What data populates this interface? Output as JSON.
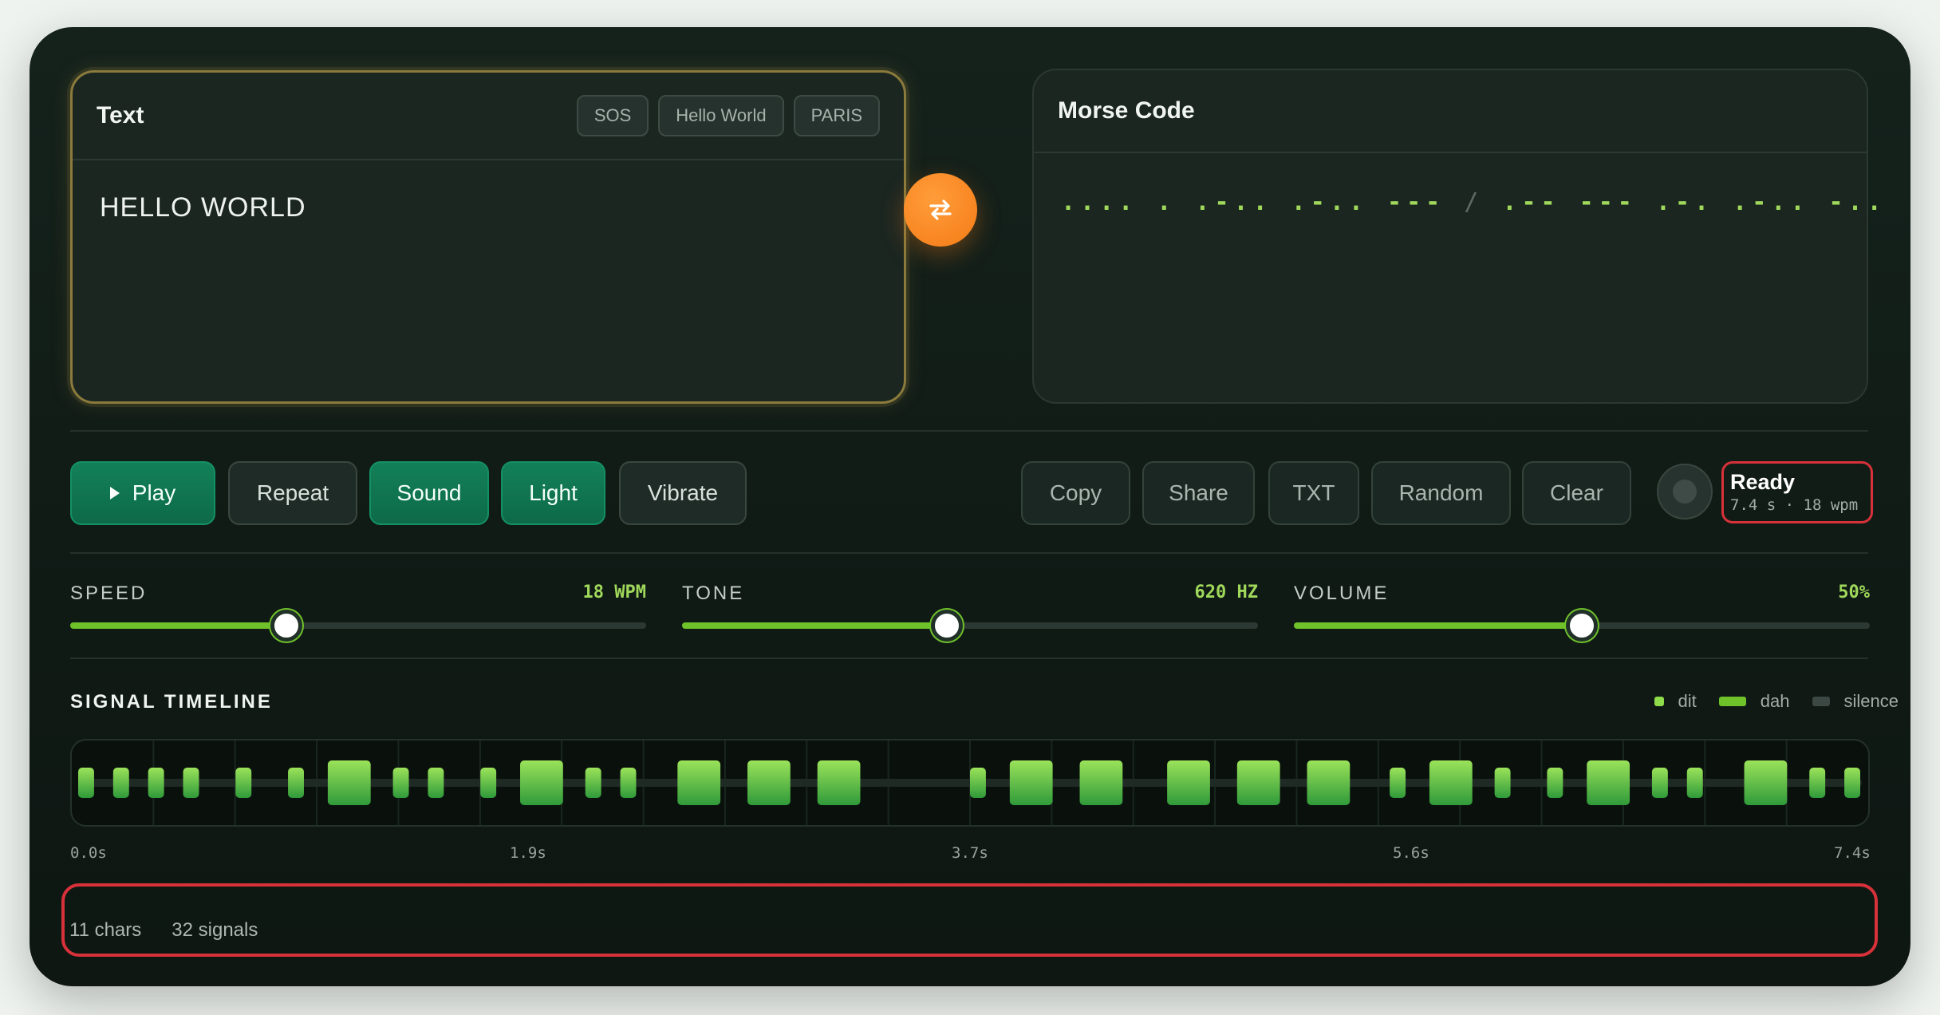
{
  "text_panel": {
    "title": "Text",
    "presets": [
      "SOS",
      "Hello World",
      "PARIS"
    ],
    "input_value": "HELLO WORLD"
  },
  "morse_panel": {
    "title": "Morse Code",
    "output": ".... . .-.. .-.. --- / .-- --- .-. .-.. -.."
  },
  "swap_icon": "swap-arrows-icon",
  "controls": {
    "play": "Play",
    "repeat": "Repeat",
    "sound": "Sound",
    "light": "Light",
    "vibrate": "Vibrate",
    "copy": "Copy",
    "share": "Share",
    "txt": "TXT",
    "random": "Random",
    "clear": "Clear"
  },
  "status": {
    "title": "Ready",
    "subtitle": "7.4 s · 18 wpm"
  },
  "sliders": {
    "speed": {
      "label": "SPEED",
      "value": "18 WPM",
      "fraction": 0.375
    },
    "tone": {
      "label": "TONE",
      "value": "620 HZ",
      "fraction": 0.46
    },
    "volume": {
      "label": "VOLUME",
      "value": "50%",
      "fraction": 0.5
    }
  },
  "timeline": {
    "title": "SIGNAL TIMELINE",
    "legend": [
      "dit",
      "dah",
      "silence"
    ],
    "axis": [
      "0.0s",
      "1.9s",
      "3.7s",
      "5.6s",
      "7.4s"
    ],
    "total_seconds": 7.4,
    "sequence": ". . . . | . | . - . . | . - . . | - - - / . - - | - - - | . - . | . - . . | - . ."
  },
  "footer": {
    "chars": "11 chars",
    "signals": "32 signals"
  },
  "colors": {
    "accent": "#f57b16",
    "active_green": "#0d6a49",
    "signal_green": "#6fc22a",
    "highlight_red": "#d7313a"
  }
}
